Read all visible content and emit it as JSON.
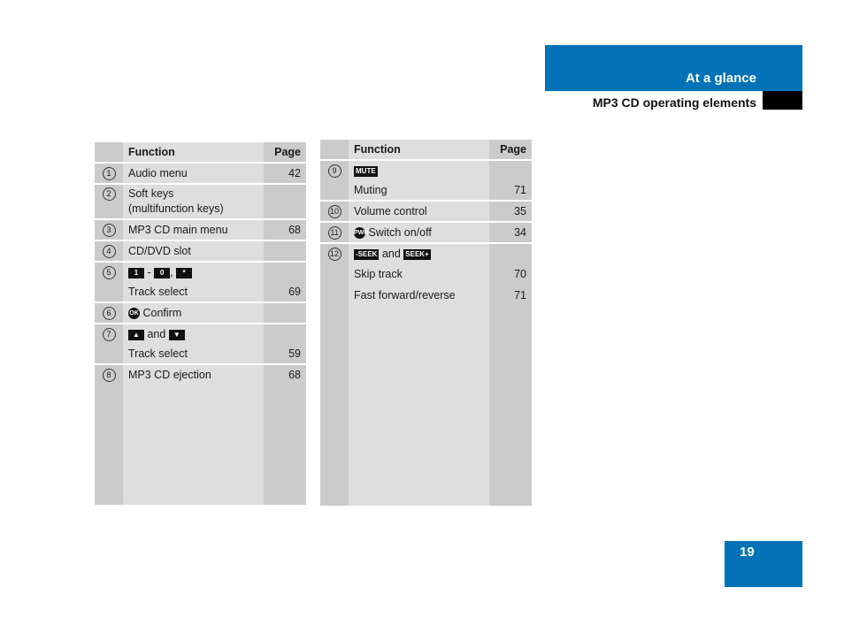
{
  "header": {
    "section": "At a glance",
    "subsection": "MP3 CD operating elements"
  },
  "page_number": "19",
  "colors": {
    "accent": "#0072b5",
    "col_dark": "#cbcbcb",
    "col_light": "#dedede"
  },
  "table_left": {
    "headers": {
      "function": "Function",
      "page": "Page"
    },
    "rows": [
      {
        "num": "1",
        "lines": [
          {
            "text": "Audio menu",
            "page": "42"
          }
        ]
      },
      {
        "num": "2",
        "lines": [
          {
            "text": "Soft keys",
            "page": ""
          },
          {
            "text": "(multifunction keys)",
            "page": ""
          }
        ]
      },
      {
        "num": "3",
        "lines": [
          {
            "text": "MP3 CD main menu",
            "page": "68"
          }
        ]
      },
      {
        "num": "4",
        "lines": [
          {
            "text": "CD/DVD slot",
            "page": ""
          }
        ]
      },
      {
        "num": "5",
        "keys": {
          "k1": "1",
          "sep1": "-",
          "k2": "0",
          "sep2": ",",
          "k3": "*"
        },
        "lines": [
          {
            "text": "Track select",
            "page": "69"
          }
        ]
      },
      {
        "num": "6",
        "icon": "OK",
        "lines": [
          {
            "text": "Confirm",
            "page": ""
          }
        ]
      },
      {
        "num": "7",
        "keys": {
          "k1": "▲",
          "sep1": "and",
          "k2": "▼"
        },
        "lines": [
          {
            "text": "Track select",
            "page": "59"
          }
        ]
      },
      {
        "num": "8",
        "lines": [
          {
            "text": "MP3 CD ejection",
            "page": "68"
          }
        ]
      }
    ]
  },
  "table_right": {
    "headers": {
      "function": "Function",
      "page": "Page"
    },
    "rows": [
      {
        "num": "9",
        "keys": {
          "k1": "MUTE"
        },
        "lines": [
          {
            "text": "Muting",
            "page": "71"
          }
        ]
      },
      {
        "num": "10",
        "lines": [
          {
            "text": "Volume control",
            "page": "35"
          }
        ]
      },
      {
        "num": "11",
        "icon": "PWR",
        "lines": [
          {
            "text": "Switch on/off",
            "page": "34"
          }
        ]
      },
      {
        "num": "12",
        "keys": {
          "k1": "-SEEK",
          "sep1": "and",
          "k2": "SEEK+"
        },
        "lines": [
          {
            "text": "Skip track",
            "page": "70"
          },
          {
            "text": "Fast forward/reverse",
            "page": "71"
          }
        ]
      }
    ]
  }
}
